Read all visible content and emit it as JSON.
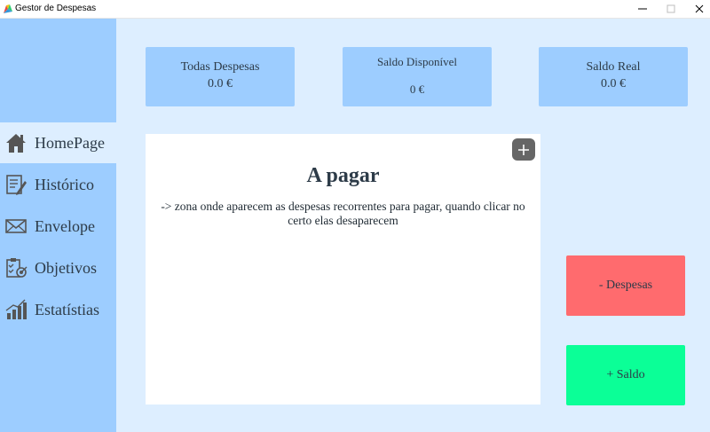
{
  "window": {
    "title": "Gestor de Despesas",
    "icons": {
      "app": "app-logo-icon",
      "minimize": "minimize-icon",
      "maximize": "maximize-icon",
      "close": "close-icon"
    }
  },
  "sidebar": {
    "items": [
      {
        "label": "HomePage",
        "icon": "home-icon",
        "active": true
      },
      {
        "label": "Histórico",
        "icon": "notepad-icon",
        "active": false
      },
      {
        "label": "Envelope",
        "icon": "envelope-icon",
        "active": false
      },
      {
        "label": "Objetivos",
        "icon": "checklist-target-icon",
        "active": false
      },
      {
        "label": "Estatístias",
        "icon": "bar-chart-icon",
        "active": false
      }
    ]
  },
  "cards": [
    {
      "label": "Todas Despesas",
      "value": "0.0 €"
    },
    {
      "label": "Saldo Disponível",
      "value": "0 €"
    },
    {
      "label": "Saldo Real",
      "value": "0.0 €"
    }
  ],
  "panel": {
    "title": "A pagar",
    "description": "-> zona onde aparecem as despesas recorrentes para pagar, quando clicar no certo elas desaparecem",
    "add_icon": "plus-icon"
  },
  "actions": {
    "despesas_label": "- Despesas",
    "saldo_label": "+ Saldo"
  },
  "colors": {
    "sidebar": "#9dcdff",
    "background": "#ddeeff",
    "card": "#9dcdff",
    "despesas": "#ff6b6e",
    "saldo": "#0bff97",
    "text": "#2d3b48"
  }
}
